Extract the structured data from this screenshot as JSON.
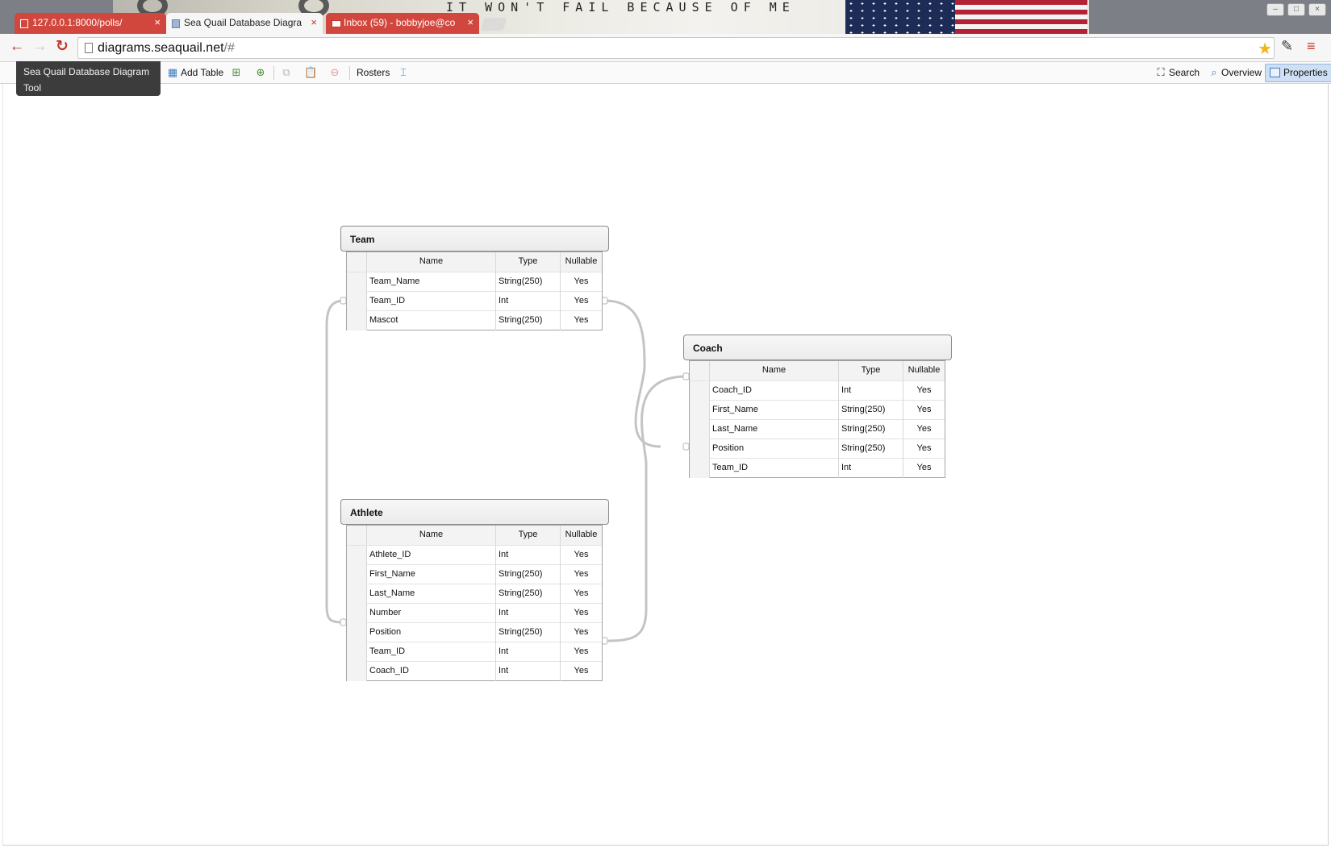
{
  "browser": {
    "tabs": [
      {
        "label": "127.0.0.1:8000/polls/",
        "state": "inactive",
        "icon": "page-icon"
      },
      {
        "label": "Sea Quail Database Diagra",
        "state": "active",
        "icon": "diagram-icon"
      },
      {
        "label": "Inbox (59) - bobbyjoe@co",
        "state": "inactive",
        "icon": "mail-icon"
      }
    ],
    "tab_close_glyph": "×",
    "wallpaper_text": "IT WON'T FAIL BECAUSE OF ME",
    "address": {
      "host": "diagrams.seaquail.net",
      "path": "/#"
    },
    "window_controls": {
      "minimize": "–",
      "maximize": "□",
      "close": "×"
    }
  },
  "app": {
    "tooltip": "Sea Quail Database Diagram Tool",
    "toolbar": {
      "add_table": "Add Table",
      "rosters": "Rosters",
      "search": "Search",
      "overview": "Overview",
      "properties": "Properties"
    }
  },
  "grid_headers": {
    "name": "Name",
    "type": "Type",
    "nullable": "Nullable"
  },
  "entities": [
    {
      "title": "Team",
      "columns": [
        {
          "name": "Team_Name",
          "type": "String(250)",
          "nullable": "Yes"
        },
        {
          "name": "Team_ID",
          "type": "Int",
          "nullable": "Yes"
        },
        {
          "name": "Mascot",
          "type": "String(250)",
          "nullable": "Yes"
        }
      ]
    },
    {
      "title": "Coach",
      "columns": [
        {
          "name": "Coach_ID",
          "type": "Int",
          "nullable": "Yes"
        },
        {
          "name": "First_Name",
          "type": "String(250)",
          "nullable": "Yes"
        },
        {
          "name": "Last_Name",
          "type": "String(250)",
          "nullable": "Yes"
        },
        {
          "name": "Position",
          "type": "String(250)",
          "nullable": "Yes"
        },
        {
          "name": "Team_ID",
          "type": "Int",
          "nullable": "Yes"
        }
      ]
    },
    {
      "title": "Athlete",
      "columns": [
        {
          "name": "Athlete_ID",
          "type": "Int",
          "nullable": "Yes"
        },
        {
          "name": "First_Name",
          "type": "String(250)",
          "nullable": "Yes"
        },
        {
          "name": "Last_Name",
          "type": "String(250)",
          "nullable": "Yes"
        },
        {
          "name": "Number",
          "type": "Int",
          "nullable": "Yes"
        },
        {
          "name": "Position",
          "type": "String(250)",
          "nullable": "Yes"
        },
        {
          "name": "Team_ID",
          "type": "Int",
          "nullable": "Yes"
        },
        {
          "name": "Coach_ID",
          "type": "Int",
          "nullable": "Yes"
        }
      ]
    }
  ],
  "relationships": [
    {
      "from": "Team.Team_ID",
      "to": "Coach.Team_ID"
    },
    {
      "from": "Team.Team_ID",
      "to": "Athlete.Team_ID"
    },
    {
      "from": "Coach.Coach_ID",
      "to": "Athlete.Coach_ID"
    }
  ],
  "colors": {
    "tab_inactive": "#d1473d",
    "tab_active": "#f6f6f6",
    "star": "#f1b51c",
    "accent_red": "#c7362c",
    "properties_active": "#cfe0f5",
    "relation_line": "#c4c4c4"
  }
}
